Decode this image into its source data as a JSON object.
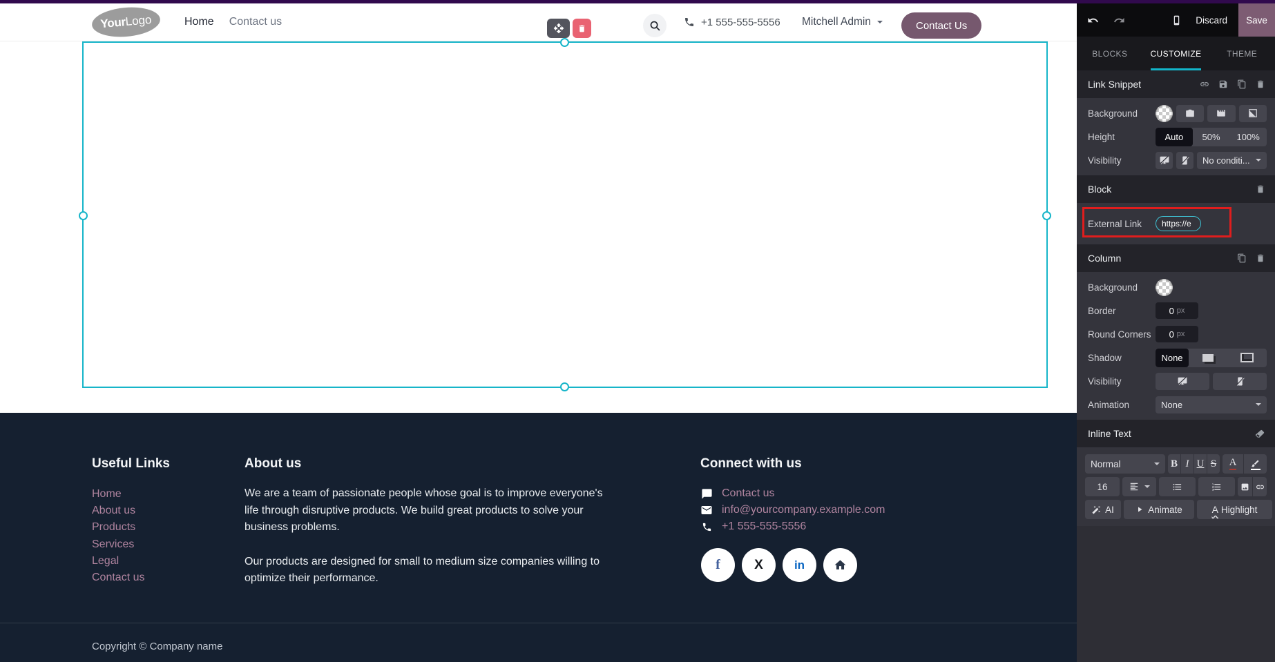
{
  "colors": {
    "accent_cyan": "#16b5c9",
    "annotation_red": "#e01d1d",
    "top_strip_purple": "#310a4d",
    "cta_mauve": "#76586e",
    "save_mauve": "#7d5c73",
    "footer_bg": "#152030",
    "footer_link_mauve": "#b0849f",
    "panel_bg": "#2e2e35"
  },
  "site": {
    "header": {
      "logo_bold": "Your",
      "logo_light": "Logo",
      "nav": [
        {
          "label": "Home"
        },
        {
          "label": "Contact us"
        }
      ],
      "phone": "+1 555-555-5556",
      "user_menu": "Mitchell Admin",
      "cta": "Contact Us"
    },
    "footer": {
      "useful_links": {
        "title": "Useful Links",
        "links": [
          {
            "label": "Home"
          },
          {
            "label": "About us"
          },
          {
            "label": "Products"
          },
          {
            "label": "Services"
          },
          {
            "label": "Legal"
          },
          {
            "label": "Contact us"
          }
        ]
      },
      "about": {
        "title": "About us",
        "paragraph1": "We are a team of passionate people whose goal is to improve everyone's life through disruptive products. We build great products to solve your business problems.",
        "paragraph2": "Our products are designed for small to medium size companies willing to optimize their performance."
      },
      "connect": {
        "title": "Connect with us",
        "contact_link": "Contact us",
        "email": "info@yourcompany.example.com",
        "phone": "+1 555-555-5556",
        "social": {
          "facebook": "f",
          "x": "X",
          "linkedin": "in"
        }
      },
      "copyright": "Copyright © Company name"
    }
  },
  "editor": {
    "toolbar": {
      "discard": "Discard",
      "save": "Save"
    },
    "tabs": [
      {
        "label": "BLOCKS"
      },
      {
        "label": "CUSTOMIZE"
      },
      {
        "label": "THEME"
      }
    ],
    "active_tab": "CUSTOMIZE",
    "link_snippet": {
      "title": "Link Snippet",
      "background_label": "Background",
      "height_label": "Height",
      "height_options": [
        {
          "label": "Auto"
        },
        {
          "label": "50%"
        },
        {
          "label": "100%"
        }
      ],
      "height_selected": "Auto",
      "visibility_label": "Visibility",
      "visibility_value": "No conditi..."
    },
    "block": {
      "title": "Block",
      "external_link_label": "External Link",
      "external_link_value": "https://e"
    },
    "column": {
      "title": "Column",
      "background_label": "Background",
      "border_label": "Border",
      "border_value": "0",
      "round_corners_label": "Round Corners",
      "round_corners_value": "0",
      "px_unit": "px",
      "shadow_label": "Shadow",
      "shadow_none": "None",
      "visibility_label": "Visibility",
      "animation_label": "Animation",
      "animation_value": "None"
    },
    "inline_text": {
      "title": "Inline Text",
      "style_value": "Normal",
      "bold": "B",
      "italic": "I",
      "underline": "U",
      "strikethrough": "S",
      "font_color_letter": "A",
      "font_size": "16",
      "ai": "AI",
      "animate": "Animate",
      "highlight_letter": "A",
      "highlight": "Highlight"
    }
  }
}
